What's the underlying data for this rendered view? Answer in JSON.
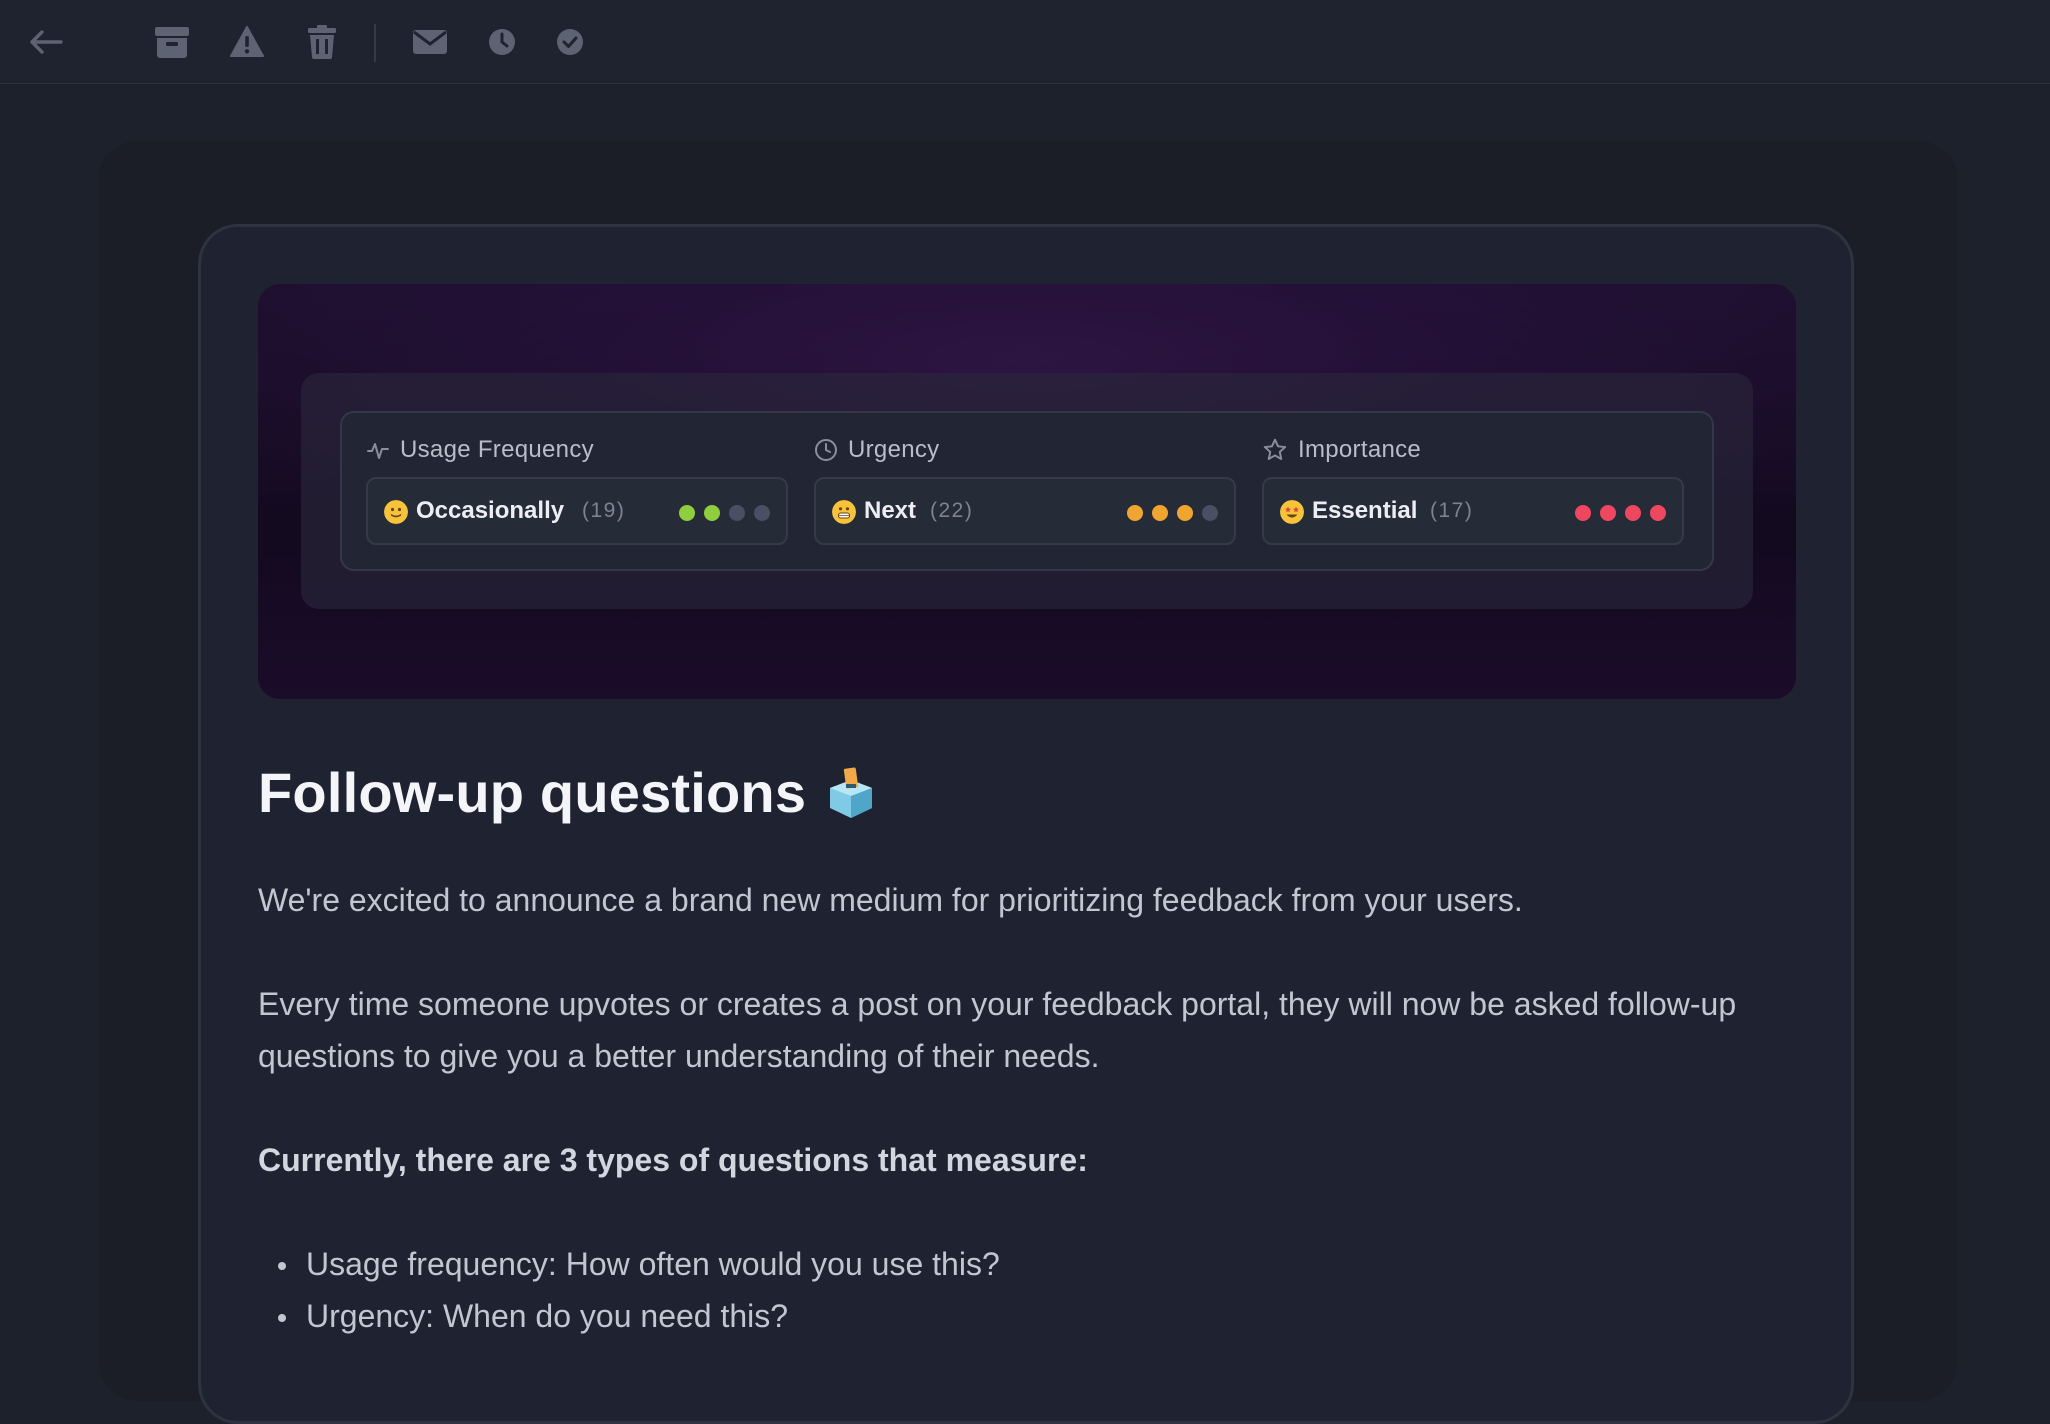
{
  "toolbar": {
    "icons": [
      "back-arrow-icon",
      "archive-icon",
      "warning-icon",
      "trash-icon",
      "mail-icon",
      "clock-icon",
      "check-circle-icon"
    ]
  },
  "hero": {
    "questions": [
      {
        "title": "Usage Frequency",
        "icon": "activity-icon",
        "answer": "Occasionally",
        "count": "(19)",
        "emoji": "slightly-smiling-face",
        "level": 2,
        "max": 4,
        "color": "#8fce3c"
      },
      {
        "title": "Urgency",
        "icon": "clock-icon",
        "answer": "Next",
        "count": "(22)",
        "emoji": "grimacing-face",
        "level": 3,
        "max": 4,
        "color": "#f0a531"
      },
      {
        "title": "Importance",
        "icon": "star-icon",
        "answer": "Essential",
        "count": "(17)",
        "emoji": "star-struck-face",
        "level": 4,
        "max": 4,
        "color": "#f04761"
      }
    ]
  },
  "content": {
    "heading": "Follow-up questions",
    "heading_emoji": "ballot-box-icon",
    "p1": "We're excited to announce a brand new medium for prioritizing feedback from your users.",
    "p2": "Every time someone upvotes or creates a post on your feedback portal, they will now be asked follow-up questions to give you a better understanding of their needs.",
    "p3": "Currently, there are 3 types of questions that measure:",
    "bullets": [
      "Usage frequency: How often would you use this?",
      "Urgency: When do you need this?"
    ]
  },
  "colors": {
    "background": "#1d212b",
    "card": "#1f2331",
    "inactive_dot": "#4a4f63",
    "emoji_yellow": "#f6c33a"
  }
}
